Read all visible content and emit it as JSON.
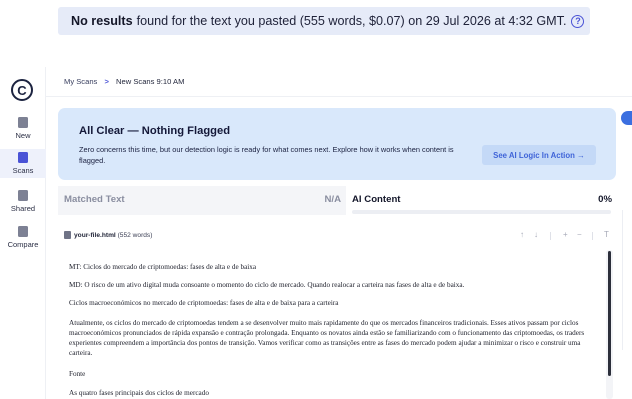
{
  "banner": {
    "bold": "No results",
    "text": "found for the text you pasted (555 words, $0.07) on 29 Jul 2026 at 4:32 GMT.",
    "help_icon": "question-circle-icon"
  },
  "sidebar": {
    "logo": "C",
    "items": [
      {
        "label": "New",
        "icon": "new-doc-icon"
      },
      {
        "label": "Scans",
        "icon": "scans-icon"
      },
      {
        "label": "Shared",
        "icon": "shared-folder-icon"
      },
      {
        "label": "Compare",
        "icon": "compare-icon"
      }
    ]
  },
  "breadcrumb": {
    "root": "My Scans",
    "separator": ">",
    "current": "New Scans 9:10 AM"
  },
  "all_clear": {
    "title": "All Clear — Nothing Flagged",
    "subtitle": "Zero concerns this time, but our detection logic is ready for what comes next. Explore how it works when content is flagged.",
    "button": "See AI Logic In Action →"
  },
  "tabs": {
    "matched": {
      "label": "Matched Text",
      "value": "N/A"
    },
    "ai": {
      "label": "AI Content",
      "value": "0%",
      "progress": 0
    }
  },
  "file": {
    "name": "your-file.html",
    "words": "(552 words)",
    "tools": [
      "↑",
      "↓",
      "+",
      "−",
      "T"
    ]
  },
  "document": [
    "MT: Ciclos do mercado de criptomoedas: fases de alta e de baixa",
    "MD: O risco de um ativo digital muda consoante o momento do ciclo de mercado. Quando realocar a carteira nas fases de alta e de baixa.",
    "Ciclos macroeconómicos no mercado de criptomoedas: fases de alta e de baixa para a carteira",
    "Atualmente, os ciclos do mercado de criptomoedas tendem a se desenvolver muito mais rapidamente do que os mercados financeiros tradicionais. Esses ativos passam por ciclos macroeconómicos pronunciados de rápida expansão e contração prolongada. Enquanto os novatos ainda estão se familiarizando com o funcionamento das criptomoedas, os traders experientes compreendem a importância dos pontos de transição. Vamos verificar como as transições entre as fases do mercado podem ajudar a minimizar o risco e construir uma carteira.",
    "Fonte",
    "As quatro fases principais dos ciclos de mercado"
  ],
  "colors": {
    "accent": "#4a53d6",
    "banner_bg": "#e6ebf8",
    "card_bg": "#d9e8fb",
    "button_text": "#3f64d8"
  }
}
